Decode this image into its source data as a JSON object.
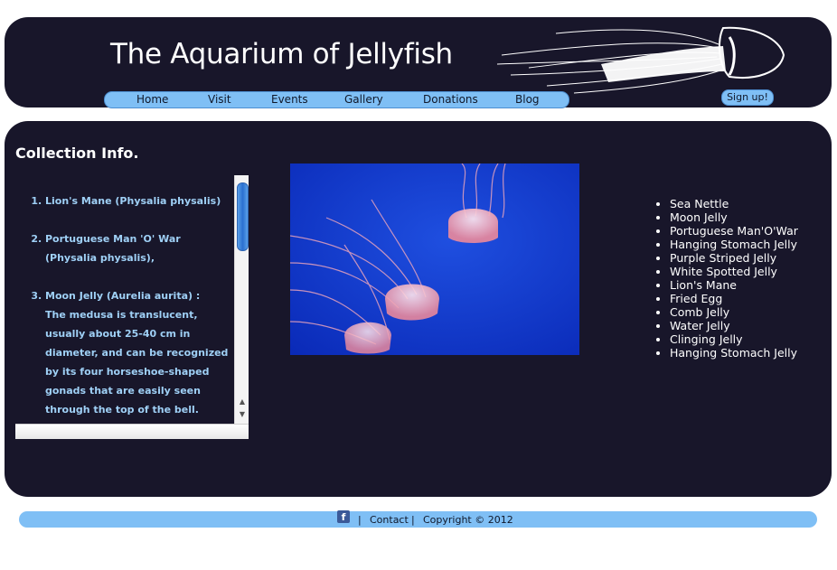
{
  "header": {
    "site_title": "The Aquarium of Jellyfish",
    "signup_label": "Sign up!",
    "nav": [
      "Home",
      "Visit",
      "Events",
      "Gallery",
      "Donations",
      "Blog"
    ]
  },
  "main": {
    "section_title": "Collection Info.",
    "collection": [
      {
        "name": "Lion's Mane (Physalia physalis)",
        "description": ""
      },
      {
        "name": "Portuguese Man 'O' War (Physalia physalis),",
        "description": ""
      },
      {
        "name": "Moon Jelly (Aurelia aurita) :",
        "description": "The medusa is translucent, usually about 25-40 cm in diameter, and can be recognized by its four horseshoe-shaped gonads that are easily seen through the top of the bell."
      }
    ],
    "species": [
      "Sea Nettle",
      "Moon Jelly",
      "Portuguese Man'O'War",
      "Hanging Stomach Jelly",
      "Purple Striped Jelly",
      "White Spotted Jelly",
      "Lion's Mane",
      "Fried Egg",
      "Comb Jelly",
      "Water Jelly",
      "Clinging Jelly",
      "Hanging Stomach Jelly"
    ]
  },
  "footer": {
    "facebook_icon": "f",
    "separator": "|",
    "contact_label": "Contact",
    "copyright": "Copyright © 2012"
  },
  "colors": {
    "panel_bg": "#18162a",
    "accent_blue": "#7fbff5",
    "list_text": "#9fd0f6"
  }
}
